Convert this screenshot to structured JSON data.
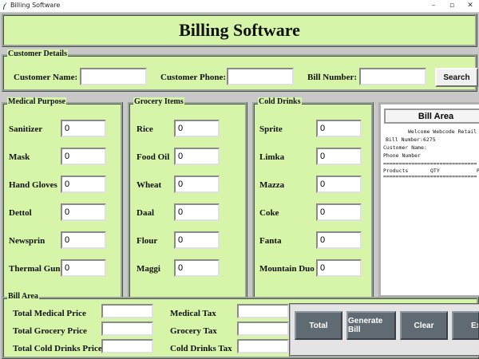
{
  "window": {
    "title": "Billing Software"
  },
  "header": {
    "title": "Billing Software"
  },
  "customer": {
    "legend": "Customer Details",
    "name_label": "Customer Name:",
    "name_value": "",
    "phone_label": "Customer Phone:",
    "phone_value": "",
    "bill_label": "Bill Number:",
    "bill_value": "",
    "search_label": "Search"
  },
  "medical": {
    "legend": "Medical Purpose",
    "items": [
      {
        "label": "Sanitizer",
        "value": "0"
      },
      {
        "label": "Mask",
        "value": "0"
      },
      {
        "label": "Hand Gloves",
        "value": "0"
      },
      {
        "label": "Dettol",
        "value": "0"
      },
      {
        "label": "Newsprin",
        "value": "0"
      },
      {
        "label": "Thermal Gun",
        "value": "0"
      }
    ]
  },
  "grocery": {
    "legend": "Grocery Items",
    "items": [
      {
        "label": "Rice",
        "value": "0"
      },
      {
        "label": "Food Oil",
        "value": "0"
      },
      {
        "label": "Wheat",
        "value": "0"
      },
      {
        "label": "Daal",
        "value": "0"
      },
      {
        "label": "Flour",
        "value": "0"
      },
      {
        "label": "Maggi",
        "value": "0"
      }
    ]
  },
  "cold": {
    "legend": "Cold Drinks",
    "items": [
      {
        "label": "Sprite",
        "value": "0"
      },
      {
        "label": "Limka",
        "value": "0"
      },
      {
        "label": "Mazza",
        "value": "0"
      },
      {
        "label": "Coke",
        "value": "0"
      },
      {
        "label": "Fanta",
        "value": "0"
      },
      {
        "label": "Mountain Duo",
        "value": "0"
      }
    ]
  },
  "bill_display": {
    "title": "Bill Area",
    "welcome": "Welcome Webcode Retail",
    "bill_number": "Bill Number:6275",
    "customer_name": "Customer Name:",
    "phone_number": "Phone Number",
    "separator": "==============================",
    "col_products": "Products",
    "col_qty": "QTY",
    "col_price": "P"
  },
  "bill_menu": {
    "legend": "Bill Area",
    "total_medical_label": "Total Medical Price",
    "total_medical_value": "",
    "total_grocery_label": "Total Grocery Price",
    "total_grocery_value": "",
    "total_cold_label": "Total Cold Drinks Price",
    "total_cold_value": "",
    "medical_tax_label": "Medical Tax",
    "medical_tax_value": "",
    "grocery_tax_label": "Grocery Tax",
    "grocery_tax_value": "",
    "cold_tax_label": "Cold Drinks Tax",
    "cold_tax_value": "",
    "total_button": "Total",
    "generate_button": "Generate Bill",
    "clear_button": "Clear",
    "exit_button": "Exit"
  }
}
